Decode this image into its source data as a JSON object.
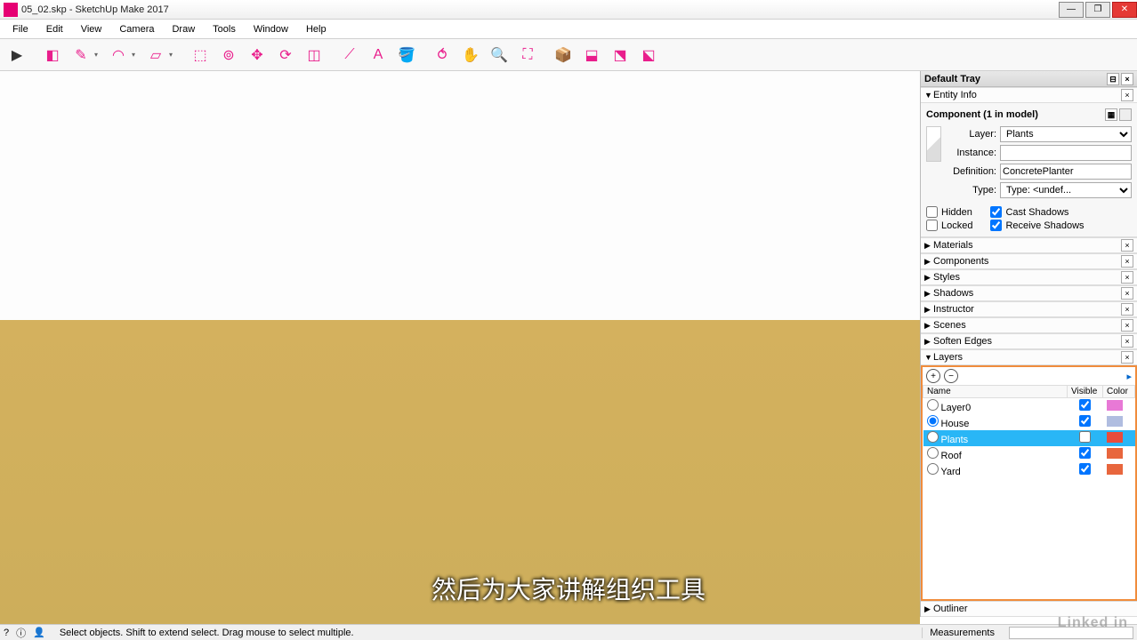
{
  "title": "05_02.skp - SketchUp Make 2017",
  "menu": [
    "File",
    "Edit",
    "View",
    "Camera",
    "Draw",
    "Tools",
    "Window",
    "Help"
  ],
  "tray": {
    "title": "Default Tray",
    "entity": {
      "header": "Entity Info",
      "component_label": "Component (1 in model)",
      "layer_label": "Layer:",
      "layer_value": "Plants",
      "instance_label": "Instance:",
      "instance_value": "",
      "definition_label": "Definition:",
      "definition_value": "ConcretePlanter",
      "type_label": "Type:",
      "type_value": "Type: <undef...",
      "hidden": "Hidden",
      "locked": "Locked",
      "cast": "Cast Shadows",
      "receive": "Receive Shadows"
    },
    "panels": [
      "Materials",
      "Components",
      "Styles",
      "Shadows",
      "Instructor",
      "Scenes",
      "Soften Edges"
    ],
    "layers_header": "Layers",
    "layers_cols": {
      "name": "Name",
      "visible": "Visible",
      "color": "Color"
    },
    "layers": [
      {
        "name": "Layer0",
        "active": false,
        "visible": true,
        "color": "#e879d6"
      },
      {
        "name": "House",
        "active": true,
        "visible": true,
        "color": "#b0bde0"
      },
      {
        "name": "Plants",
        "active": false,
        "visible": false,
        "color": "#e84c3d",
        "sel": true
      },
      {
        "name": "Roof",
        "active": false,
        "visible": true,
        "color": "#e8663d"
      },
      {
        "name": "Yard",
        "active": false,
        "visible": true,
        "color": "#e8663d"
      }
    ],
    "outliner": "Outliner"
  },
  "status": {
    "hint": "Select objects. Shift to extend select. Drag mouse to select multiple.",
    "measurements_label": "Measurements"
  },
  "subtitle": "然后为大家讲解组织工具",
  "watermark": "Linked in"
}
